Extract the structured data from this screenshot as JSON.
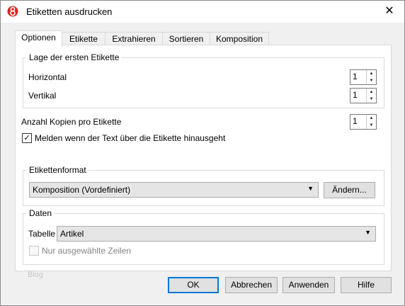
{
  "window": {
    "title": "Etiketten ausdrucken",
    "close_glyph": "✕",
    "app_icon_color": "#d9261c"
  },
  "tabs": [
    "Optionen",
    "Etikette",
    "Extrahieren",
    "Sortieren",
    "Komposition"
  ],
  "position_group": {
    "title": "Lage der ersten Etikette",
    "horizontal_label": "Horizontal",
    "horizontal_value": "1",
    "vertical_label": "Vertikal",
    "vertical_value": "1"
  },
  "copies": {
    "label": "Anzahl Kopien pro Etikette",
    "value": "1"
  },
  "warn_checkbox": {
    "label": "Melden wenn der Text über die Etikette hinausgeht",
    "checked": true,
    "mark": "✓"
  },
  "format_group": {
    "title": "Etikettenformat",
    "selected": "Komposition (Vordefiniert)",
    "change_button": "Ändern..."
  },
  "data_group": {
    "title": "Daten",
    "table_label": "Tabelle",
    "table_selected": "Artikel",
    "selected_rows_label": "Nur ausgewählte Zeilen",
    "selected_rows_checked": false
  },
  "faint_text": "Blog",
  "buttons": {
    "ok": "OK",
    "cancel": "Abbrechen",
    "apply": "Anwenden",
    "help": "Hilfe"
  },
  "icons": {
    "spin_up": "▲",
    "spin_down": "▼",
    "dropdown": "▼"
  }
}
